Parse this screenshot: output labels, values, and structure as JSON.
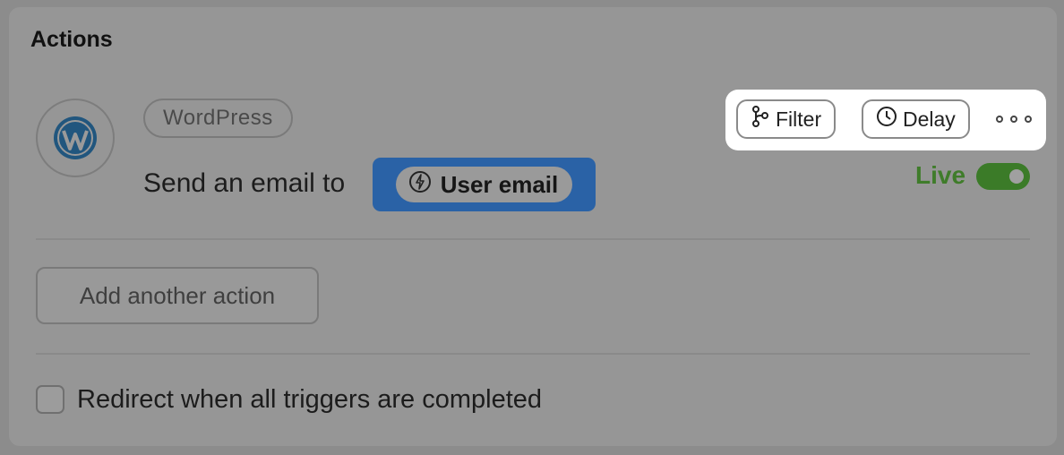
{
  "section": {
    "title": "Actions"
  },
  "action": {
    "icon": "wordpress-logo-icon",
    "platform": "WordPress",
    "description": "Send an email to",
    "token": {
      "icon": "lightning-bolt-icon",
      "label": "User email"
    }
  },
  "toolbar": {
    "filter": {
      "icon": "git-branch-icon",
      "label": "Filter"
    },
    "delay": {
      "icon": "clock-icon",
      "label": "Delay"
    },
    "more": {
      "icon": "more-options-icon"
    }
  },
  "status": {
    "label": "Live",
    "enabled": true,
    "color": "#3f7c2a"
  },
  "add_action": {
    "label": "Add another action"
  },
  "redirect": {
    "label": "Redirect when all triggers are completed",
    "checked": false
  },
  "colors": {
    "token_bg": "#2a62a6",
    "toolbar_bg": "#ffffff",
    "overlay": "#969696"
  }
}
